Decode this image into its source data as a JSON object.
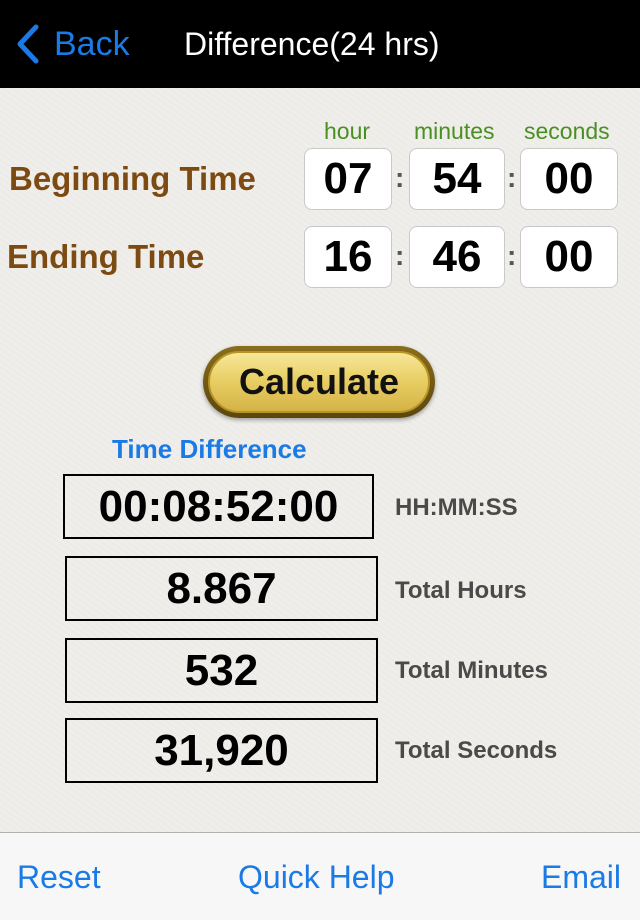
{
  "navbar": {
    "back_label": "Back",
    "back_icon": "chevron-left-icon",
    "title": "Difference(24 hrs)"
  },
  "columns": {
    "hour": "hour",
    "minutes": "minutes",
    "seconds": "seconds"
  },
  "beginning": {
    "label": "Beginning Time",
    "hour": "07",
    "minutes": "54",
    "seconds": "00"
  },
  "ending": {
    "label": "Ending Time",
    "hour": "16",
    "minutes": "46",
    "seconds": "00"
  },
  "separator": ":",
  "calculate_label": "Calculate",
  "results": {
    "title": "Time Difference",
    "items": [
      {
        "value": "00:08:52:00",
        "label": "HH:MM:SS"
      },
      {
        "value": "8.867",
        "label": "Total Hours"
      },
      {
        "value": "532",
        "label": "Total Minutes"
      },
      {
        "value": "31,920",
        "label": "Total Seconds"
      }
    ]
  },
  "toolbar": {
    "reset": "Reset",
    "quick_help": "Quick Help",
    "email": "Email"
  },
  "colors": {
    "accent": "#1a7ae6",
    "label_brown": "#7d4a12",
    "column_green": "#4a8f22"
  }
}
